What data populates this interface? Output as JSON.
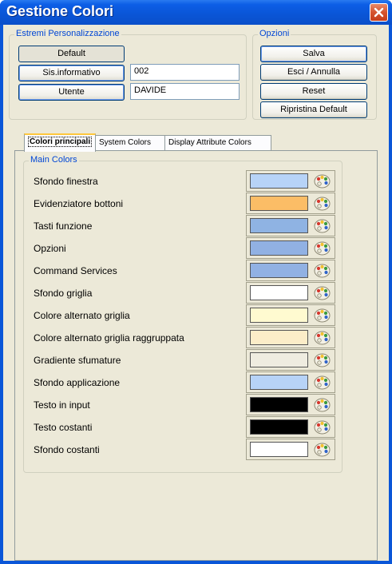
{
  "window": {
    "title": "Gestione Colori"
  },
  "personalizzazione": {
    "legend": "Estremi Personalizzazione",
    "default_label": "Default",
    "sis_label": "Sis.informativo",
    "sis_value": "002",
    "utente_label": "Utente",
    "utente_value": "DAVIDE"
  },
  "opzioni": {
    "legend": "Opzioni",
    "salva": "Salva",
    "esci": "Esci / Annulla",
    "reset": "Reset",
    "ripristina": "Ripristina Default"
  },
  "tabs": [
    {
      "label": "Colori principali",
      "active": true
    },
    {
      "label": "System Colors",
      "active": false
    },
    {
      "label": "Display Attribute Colors",
      "active": false
    }
  ],
  "main_colors": {
    "legend": "Main Colors",
    "rows": [
      {
        "label": "Sfondo finestra",
        "color": "#b7d3f7"
      },
      {
        "label": "Evidenziatore bottoni",
        "color": "#fbbd66"
      },
      {
        "label": "Tasti funzione",
        "color": "#8fb3e3"
      },
      {
        "label": "Opzioni",
        "color": "#91b1e3"
      },
      {
        "label": "Command Services",
        "color": "#91b1e3"
      },
      {
        "label": "Sfondo griglia",
        "color": "#ffffff"
      },
      {
        "label": "Colore alternato griglia",
        "color": "#fffad0"
      },
      {
        "label": "Colore alternato griglia raggruppata",
        "color": "#fcedc8"
      },
      {
        "label": "Gradiente sfumature",
        "color": "#efece0"
      },
      {
        "label": "Sfondo applicazione",
        "color": "#b7d3f7"
      },
      {
        "label": "Testo in input",
        "color": "#000000"
      },
      {
        "label": "Testo costanti",
        "color": "#000000"
      },
      {
        "label": "Sfondo costanti",
        "color": "#ffffff"
      }
    ]
  },
  "icons": {
    "close": "close-icon",
    "picker": "color-palette-icon"
  }
}
